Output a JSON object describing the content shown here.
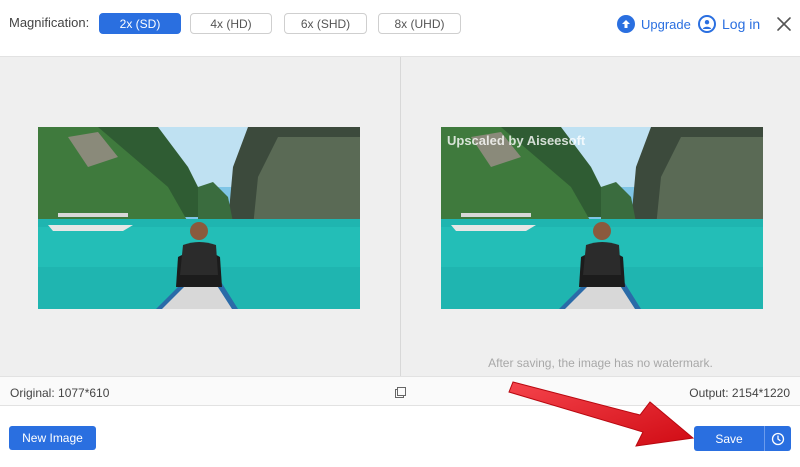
{
  "toolbar": {
    "magnification_label": "Magnification:",
    "options": [
      "2x (SD)",
      "4x (HD)",
      "6x (SHD)",
      "8x (UHD)"
    ],
    "selected": "2x (SD)",
    "upgrade_label": "Upgrade",
    "login_label": "Log in"
  },
  "preview": {
    "watermark": "Upscaled by Aiseesoft",
    "note": "After saving, the image has no watermark."
  },
  "status": {
    "original": "Original: 1077*610",
    "output": "Output: 2154*1220"
  },
  "actions": {
    "new_image_label": "New Image",
    "save_label": "Save"
  },
  "icons": [
    "upgrade-icon",
    "user-icon",
    "close-icon",
    "compare-icon",
    "history-icon"
  ],
  "colors": {
    "accent": "#2a6fe0",
    "annotation_arrow": "#e8121b"
  }
}
